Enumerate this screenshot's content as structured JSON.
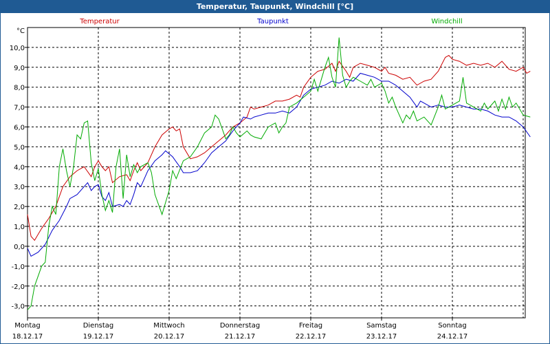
{
  "window": {
    "title": "Temperatur, Taupunkt, Windchill [°C]"
  },
  "chart_data": {
    "type": "line",
    "title": "Temperatur, Taupunkt, Windchill [°C]",
    "ylabel": "°C",
    "ylim": [
      -3.6,
      11.0
    ],
    "yticks": [
      -3.0,
      -2.0,
      -1.0,
      0.0,
      1.0,
      2.0,
      3.0,
      4.0,
      5.0,
      6.0,
      7.0,
      8.0,
      9.0,
      10.0
    ],
    "ytick_labels": [
      "-3,0",
      "-2,0",
      "-1,0",
      "0,0",
      "1,0",
      "2,0",
      "3,0",
      "4,0",
      "5,0",
      "6,0",
      "7,0",
      "8,0",
      "9,0",
      "10,0"
    ],
    "x_unit": "days",
    "xlim": [
      0,
      7
    ],
    "day_labels": [
      {
        "day": "Montag",
        "date": "18.12.17"
      },
      {
        "day": "Dienstag",
        "date": "19.12.17"
      },
      {
        "day": "Mittwoch",
        "date": "20.12.17"
      },
      {
        "day": "Donnerstag",
        "date": "21.12.17"
      },
      {
        "day": "Freitag",
        "date": "22.12.17"
      },
      {
        "day": "Samstag",
        "date": "23.12.17"
      },
      {
        "day": "Sonntag",
        "date": "24.12.17"
      }
    ],
    "grid": true,
    "legend_position": "top",
    "series": [
      {
        "name": "Temperatur",
        "color": "#cc0000",
        "points": [
          [
            0.0,
            1.6
          ],
          [
            0.05,
            0.5
          ],
          [
            0.1,
            0.3
          ],
          [
            0.2,
            0.9
          ],
          [
            0.3,
            1.4
          ],
          [
            0.4,
            2.0
          ],
          [
            0.45,
            2.5
          ],
          [
            0.5,
            3.0
          ],
          [
            0.6,
            3.5
          ],
          [
            0.7,
            3.8
          ],
          [
            0.8,
            4.0
          ],
          [
            0.9,
            3.5
          ],
          [
            0.95,
            4.0
          ],
          [
            1.0,
            4.3
          ],
          [
            1.05,
            4.0
          ],
          [
            1.1,
            3.8
          ],
          [
            1.15,
            4.0
          ],
          [
            1.2,
            3.2
          ],
          [
            1.3,
            3.5
          ],
          [
            1.4,
            3.6
          ],
          [
            1.45,
            3.3
          ],
          [
            1.5,
            3.8
          ],
          [
            1.55,
            4.2
          ],
          [
            1.6,
            3.8
          ],
          [
            1.7,
            4.2
          ],
          [
            1.8,
            5.0
          ],
          [
            1.9,
            5.6
          ],
          [
            2.0,
            5.9
          ],
          [
            2.05,
            6.0
          ],
          [
            2.1,
            5.8
          ],
          [
            2.15,
            5.9
          ],
          [
            2.2,
            5.0
          ],
          [
            2.3,
            4.4
          ],
          [
            2.4,
            4.5
          ],
          [
            2.5,
            4.7
          ],
          [
            2.6,
            5.0
          ],
          [
            2.7,
            5.3
          ],
          [
            2.8,
            5.6
          ],
          [
            2.9,
            6.0
          ],
          [
            3.0,
            6.2
          ],
          [
            3.1,
            6.5
          ],
          [
            3.15,
            7.0
          ],
          [
            3.2,
            6.9
          ],
          [
            3.3,
            7.0
          ],
          [
            3.4,
            7.1
          ],
          [
            3.5,
            7.3
          ],
          [
            3.6,
            7.3
          ],
          [
            3.7,
            7.4
          ],
          [
            3.8,
            7.6
          ],
          [
            3.85,
            7.5
          ],
          [
            3.9,
            8.0
          ],
          [
            4.0,
            8.5
          ],
          [
            4.1,
            8.8
          ],
          [
            4.2,
            8.9
          ],
          [
            4.3,
            9.2
          ],
          [
            4.35,
            8.8
          ],
          [
            4.4,
            9.3
          ],
          [
            4.5,
            8.8
          ],
          [
            4.55,
            8.5
          ],
          [
            4.6,
            9.0
          ],
          [
            4.7,
            9.2
          ],
          [
            4.8,
            9.1
          ],
          [
            4.9,
            9.0
          ],
          [
            5.0,
            8.8
          ],
          [
            5.05,
            9.0
          ],
          [
            5.1,
            8.7
          ],
          [
            5.2,
            8.6
          ],
          [
            5.3,
            8.4
          ],
          [
            5.4,
            8.5
          ],
          [
            5.5,
            8.1
          ],
          [
            5.6,
            8.3
          ],
          [
            5.7,
            8.4
          ],
          [
            5.8,
            8.8
          ],
          [
            5.9,
            9.5
          ],
          [
            5.95,
            9.6
          ],
          [
            6.0,
            9.4
          ],
          [
            6.1,
            9.3
          ],
          [
            6.2,
            9.1
          ],
          [
            6.3,
            9.2
          ],
          [
            6.4,
            9.1
          ],
          [
            6.5,
            9.2
          ],
          [
            6.6,
            9.0
          ],
          [
            6.7,
            9.3
          ],
          [
            6.8,
            8.9
          ],
          [
            6.9,
            8.8
          ],
          [
            7.0,
            9.0
          ],
          [
            7.05,
            8.7
          ],
          [
            7.1,
            8.8
          ]
        ]
      },
      {
        "name": "Taupunkt",
        "color": "#0000cc",
        "points": [
          [
            0.0,
            -0.1
          ],
          [
            0.05,
            -0.5
          ],
          [
            0.15,
            -0.3
          ],
          [
            0.25,
            0.1
          ],
          [
            0.35,
            0.8
          ],
          [
            0.45,
            1.3
          ],
          [
            0.55,
            2.0
          ],
          [
            0.6,
            2.4
          ],
          [
            0.7,
            2.6
          ],
          [
            0.8,
            3.0
          ],
          [
            0.85,
            3.2
          ],
          [
            0.9,
            2.8
          ],
          [
            0.95,
            3.0
          ],
          [
            1.0,
            3.1
          ],
          [
            1.05,
            2.5
          ],
          [
            1.1,
            2.3
          ],
          [
            1.15,
            2.7
          ],
          [
            1.2,
            2.0
          ],
          [
            1.3,
            2.1
          ],
          [
            1.35,
            2.0
          ],
          [
            1.4,
            2.3
          ],
          [
            1.45,
            2.1
          ],
          [
            1.5,
            2.6
          ],
          [
            1.55,
            3.2
          ],
          [
            1.6,
            3.0
          ],
          [
            1.7,
            3.8
          ],
          [
            1.8,
            4.3
          ],
          [
            1.9,
            4.6
          ],
          [
            1.95,
            4.8
          ],
          [
            2.05,
            4.5
          ],
          [
            2.15,
            4.0
          ],
          [
            2.2,
            3.7
          ],
          [
            2.3,
            3.7
          ],
          [
            2.4,
            3.8
          ],
          [
            2.5,
            4.2
          ],
          [
            2.6,
            4.7
          ],
          [
            2.7,
            5.0
          ],
          [
            2.8,
            5.3
          ],
          [
            2.9,
            5.8
          ],
          [
            3.0,
            6.2
          ],
          [
            3.05,
            6.5
          ],
          [
            3.15,
            6.4
          ],
          [
            3.2,
            6.5
          ],
          [
            3.3,
            6.6
          ],
          [
            3.4,
            6.7
          ],
          [
            3.5,
            6.7
          ],
          [
            3.6,
            6.8
          ],
          [
            3.7,
            6.7
          ],
          [
            3.8,
            7.0
          ],
          [
            3.9,
            7.6
          ],
          [
            4.0,
            7.9
          ],
          [
            4.1,
            8.0
          ],
          [
            4.2,
            8.1
          ],
          [
            4.3,
            8.3
          ],
          [
            4.4,
            8.2
          ],
          [
            4.5,
            8.4
          ],
          [
            4.6,
            8.3
          ],
          [
            4.7,
            8.7
          ],
          [
            4.8,
            8.6
          ],
          [
            4.9,
            8.5
          ],
          [
            5.0,
            8.3
          ],
          [
            5.1,
            8.3
          ],
          [
            5.2,
            8.1
          ],
          [
            5.3,
            7.8
          ],
          [
            5.4,
            7.5
          ],
          [
            5.5,
            7.0
          ],
          [
            5.55,
            7.3
          ],
          [
            5.6,
            7.2
          ],
          [
            5.7,
            7.0
          ],
          [
            5.8,
            7.1
          ],
          [
            5.9,
            7.0
          ],
          [
            6.0,
            7.0
          ],
          [
            6.1,
            7.1
          ],
          [
            6.2,
            7.0
          ],
          [
            6.3,
            6.9
          ],
          [
            6.4,
            6.9
          ],
          [
            6.5,
            6.8
          ],
          [
            6.6,
            6.6
          ],
          [
            6.7,
            6.5
          ],
          [
            6.8,
            6.5
          ],
          [
            6.9,
            6.3
          ],
          [
            7.0,
            6.0
          ],
          [
            7.1,
            5.5
          ]
        ]
      },
      {
        "name": "Windchill",
        "color": "#00aa00",
        "points": [
          [
            0.0,
            -3.2
          ],
          [
            0.05,
            -3.0
          ],
          [
            0.1,
            -2.0
          ],
          [
            0.2,
            -1.0
          ],
          [
            0.25,
            -0.8
          ],
          [
            0.3,
            1.0
          ],
          [
            0.35,
            2.0
          ],
          [
            0.4,
            1.6
          ],
          [
            0.45,
            4.0
          ],
          [
            0.5,
            4.9
          ],
          [
            0.55,
            3.8
          ],
          [
            0.6,
            3.0
          ],
          [
            0.65,
            4.0
          ],
          [
            0.7,
            5.6
          ],
          [
            0.75,
            5.4
          ],
          [
            0.8,
            6.2
          ],
          [
            0.85,
            6.3
          ],
          [
            0.9,
            4.2
          ],
          [
            0.95,
            3.3
          ],
          [
            1.0,
            3.9
          ],
          [
            1.05,
            2.6
          ],
          [
            1.1,
            1.8
          ],
          [
            1.15,
            2.3
          ],
          [
            1.2,
            1.7
          ],
          [
            1.25,
            4.0
          ],
          [
            1.3,
            4.9
          ],
          [
            1.35,
            2.4
          ],
          [
            1.4,
            4.6
          ],
          [
            1.45,
            3.5
          ],
          [
            1.5,
            4.1
          ],
          [
            1.55,
            3.7
          ],
          [
            1.6,
            4.0
          ],
          [
            1.7,
            4.2
          ],
          [
            1.75,
            3.7
          ],
          [
            1.8,
            2.6
          ],
          [
            1.9,
            1.6
          ],
          [
            1.95,
            2.2
          ],
          [
            2.0,
            2.8
          ],
          [
            2.05,
            3.8
          ],
          [
            2.1,
            3.4
          ],
          [
            2.2,
            4.3
          ],
          [
            2.3,
            4.5
          ],
          [
            2.4,
            5.0
          ],
          [
            2.5,
            5.7
          ],
          [
            2.6,
            6.0
          ],
          [
            2.65,
            6.6
          ],
          [
            2.7,
            6.4
          ],
          [
            2.8,
            5.4
          ],
          [
            2.85,
            5.6
          ],
          [
            2.9,
            6.0
          ],
          [
            2.95,
            5.7
          ],
          [
            3.0,
            5.5
          ],
          [
            3.1,
            5.8
          ],
          [
            3.15,
            5.6
          ],
          [
            3.2,
            5.5
          ],
          [
            3.3,
            5.4
          ],
          [
            3.4,
            6.0
          ],
          [
            3.5,
            6.2
          ],
          [
            3.55,
            5.7
          ],
          [
            3.6,
            6.0
          ],
          [
            3.65,
            6.2
          ],
          [
            3.7,
            7.0
          ],
          [
            3.8,
            7.2
          ],
          [
            3.9,
            7.5
          ],
          [
            4.0,
            7.8
          ],
          [
            4.05,
            8.4
          ],
          [
            4.1,
            7.8
          ],
          [
            4.2,
            9.0
          ],
          [
            4.25,
            9.5
          ],
          [
            4.3,
            8.5
          ],
          [
            4.35,
            8.0
          ],
          [
            4.4,
            10.5
          ],
          [
            4.45,
            8.6
          ],
          [
            4.5,
            8.0
          ],
          [
            4.55,
            8.3
          ],
          [
            4.6,
            8.5
          ],
          [
            4.7,
            8.3
          ],
          [
            4.8,
            8.1
          ],
          [
            4.85,
            8.4
          ],
          [
            4.9,
            8.0
          ],
          [
            5.0,
            8.2
          ],
          [
            5.05,
            7.8
          ],
          [
            5.1,
            7.2
          ],
          [
            5.15,
            7.5
          ],
          [
            5.2,
            7.0
          ],
          [
            5.3,
            6.2
          ],
          [
            5.35,
            6.6
          ],
          [
            5.4,
            6.4
          ],
          [
            5.45,
            6.8
          ],
          [
            5.5,
            6.3
          ],
          [
            5.6,
            6.5
          ],
          [
            5.7,
            6.1
          ],
          [
            5.8,
            7.0
          ],
          [
            5.85,
            7.6
          ],
          [
            5.9,
            6.9
          ],
          [
            6.0,
            7.1
          ],
          [
            6.1,
            7.3
          ],
          [
            6.15,
            8.5
          ],
          [
            6.2,
            7.2
          ],
          [
            6.3,
            7.0
          ],
          [
            6.4,
            6.8
          ],
          [
            6.45,
            7.2
          ],
          [
            6.5,
            6.9
          ],
          [
            6.6,
            7.3
          ],
          [
            6.65,
            6.8
          ],
          [
            6.7,
            7.4
          ],
          [
            6.75,
            6.9
          ],
          [
            6.8,
            7.5
          ],
          [
            6.85,
            7.0
          ],
          [
            6.9,
            7.2
          ],
          [
            6.95,
            6.9
          ],
          [
            7.0,
            6.6
          ],
          [
            7.1,
            6.5
          ]
        ]
      }
    ]
  }
}
